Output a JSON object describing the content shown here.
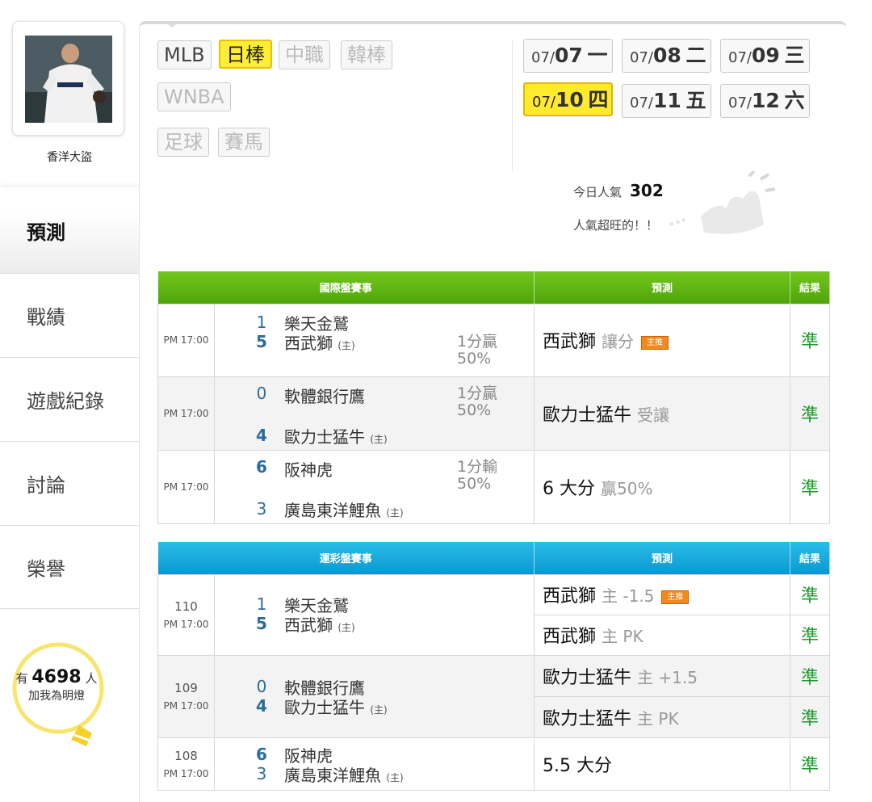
{
  "user": {
    "name": "香洋大盜"
  },
  "nav": [
    {
      "label": "預測",
      "active": true
    },
    {
      "label": "戰績",
      "active": false
    },
    {
      "label": "遊戲紀錄",
      "active": false
    },
    {
      "label": "討論",
      "active": false
    },
    {
      "label": "榮譽",
      "active": false
    }
  ],
  "lightbulb": {
    "prefix": "有",
    "count": "4698",
    "suffix": "人",
    "line2": "加我為明燈"
  },
  "league_tabs": [
    {
      "label": "MLB",
      "state": "normal"
    },
    {
      "label": "日棒",
      "state": "selected"
    },
    {
      "label": "中職",
      "state": "disabled"
    },
    {
      "label": "韓棒",
      "state": "disabled"
    },
    {
      "label": "WNBA",
      "state": "disabled"
    },
    {
      "label": "足球",
      "state": "disabled"
    },
    {
      "label": "賽馬",
      "state": "disabled"
    }
  ],
  "dates": [
    {
      "md": "07/",
      "day": "07",
      "wd": "一",
      "selected": false
    },
    {
      "md": "07/",
      "day": "08",
      "wd": "二",
      "selected": false
    },
    {
      "md": "07/",
      "day": "09",
      "wd": "三",
      "selected": false
    },
    {
      "md": "07/",
      "day": "10",
      "wd": "四",
      "selected": true
    },
    {
      "md": "07/",
      "day": "11",
      "wd": "五",
      "selected": false
    },
    {
      "md": "07/",
      "day": "12",
      "wd": "六",
      "selected": false
    }
  ],
  "popularity": {
    "label": "今日人氣",
    "value": "302",
    "message": "人氣超旺的！！"
  },
  "intl_table": {
    "headers": [
      "國際盤賽事",
      "預測",
      "結果"
    ],
    "rows": [
      {
        "time": "PM 17:00",
        "away_score": "1",
        "away_team": "樂天金鷲",
        "home_score": "5",
        "home_team": "西武獅",
        "home_mark": "(主)",
        "odds1": "1分贏",
        "odds2": "50%",
        "pred": "西武獅",
        "pred_note": "讓分",
        "badge": "主推",
        "result": "準"
      },
      {
        "time": "PM 17:00",
        "away_score": "0",
        "away_team": "軟體銀行鷹",
        "home_score": "4",
        "home_team": "歐力士猛牛",
        "home_mark": "(主)",
        "odds1": "1分贏",
        "odds2": "50%",
        "pred": "歐力士猛牛",
        "pred_note": "受讓",
        "badge": "",
        "result": "準"
      },
      {
        "time": "PM 17:00",
        "away_score": "6",
        "away_team": "阪神虎",
        "home_score": "3",
        "home_team": "廣島東洋鯉魚",
        "home_mark": "(主)",
        "odds1": "1分輸",
        "odds2": "50%",
        "pred": "6 大分",
        "pred_note": "贏50%",
        "badge": "",
        "result": "準"
      }
    ]
  },
  "sports_table": {
    "headers": [
      "運彩盤賽事",
      "預測",
      "結果"
    ],
    "rows": [
      {
        "code": "110",
        "time": "PM 17:00",
        "away_score": "1",
        "away_team": "樂天金鷲",
        "home_score": "5",
        "home_team": "西武獅",
        "home_mark": "(主)",
        "preds": [
          {
            "team": "西武獅",
            "note": "主 -1.5",
            "badge": "主推",
            "result": "準"
          },
          {
            "team": "西武獅",
            "note": "主 PK",
            "badge": "",
            "result": "準"
          }
        ]
      },
      {
        "code": "109",
        "time": "PM 17:00",
        "away_score": "0",
        "away_team": "軟體銀行鷹",
        "home_score": "4",
        "home_team": "歐力士猛牛",
        "home_mark": "(主)",
        "preds": [
          {
            "team": "歐力士猛牛",
            "note": "主 +1.5",
            "badge": "",
            "result": "準"
          },
          {
            "team": "歐力士猛牛",
            "note": "主 PK",
            "badge": "",
            "result": "準"
          }
        ]
      },
      {
        "code": "108",
        "time": "PM 17:00",
        "away_score": "6",
        "away_team": "阪神虎",
        "home_score": "3",
        "home_team": "廣島東洋鯉魚",
        "home_mark": "(主)",
        "preds": [
          {
            "team": "5.5 大分",
            "note": "",
            "badge": "",
            "result": "準"
          }
        ]
      }
    ]
  },
  "colors": {
    "accent_yellow": "#ffea2e",
    "green_header": "#5bb012",
    "blue_header": "#14a8dd",
    "result_green": "#1a9a2a",
    "badge_orange": "#f08a1c"
  }
}
